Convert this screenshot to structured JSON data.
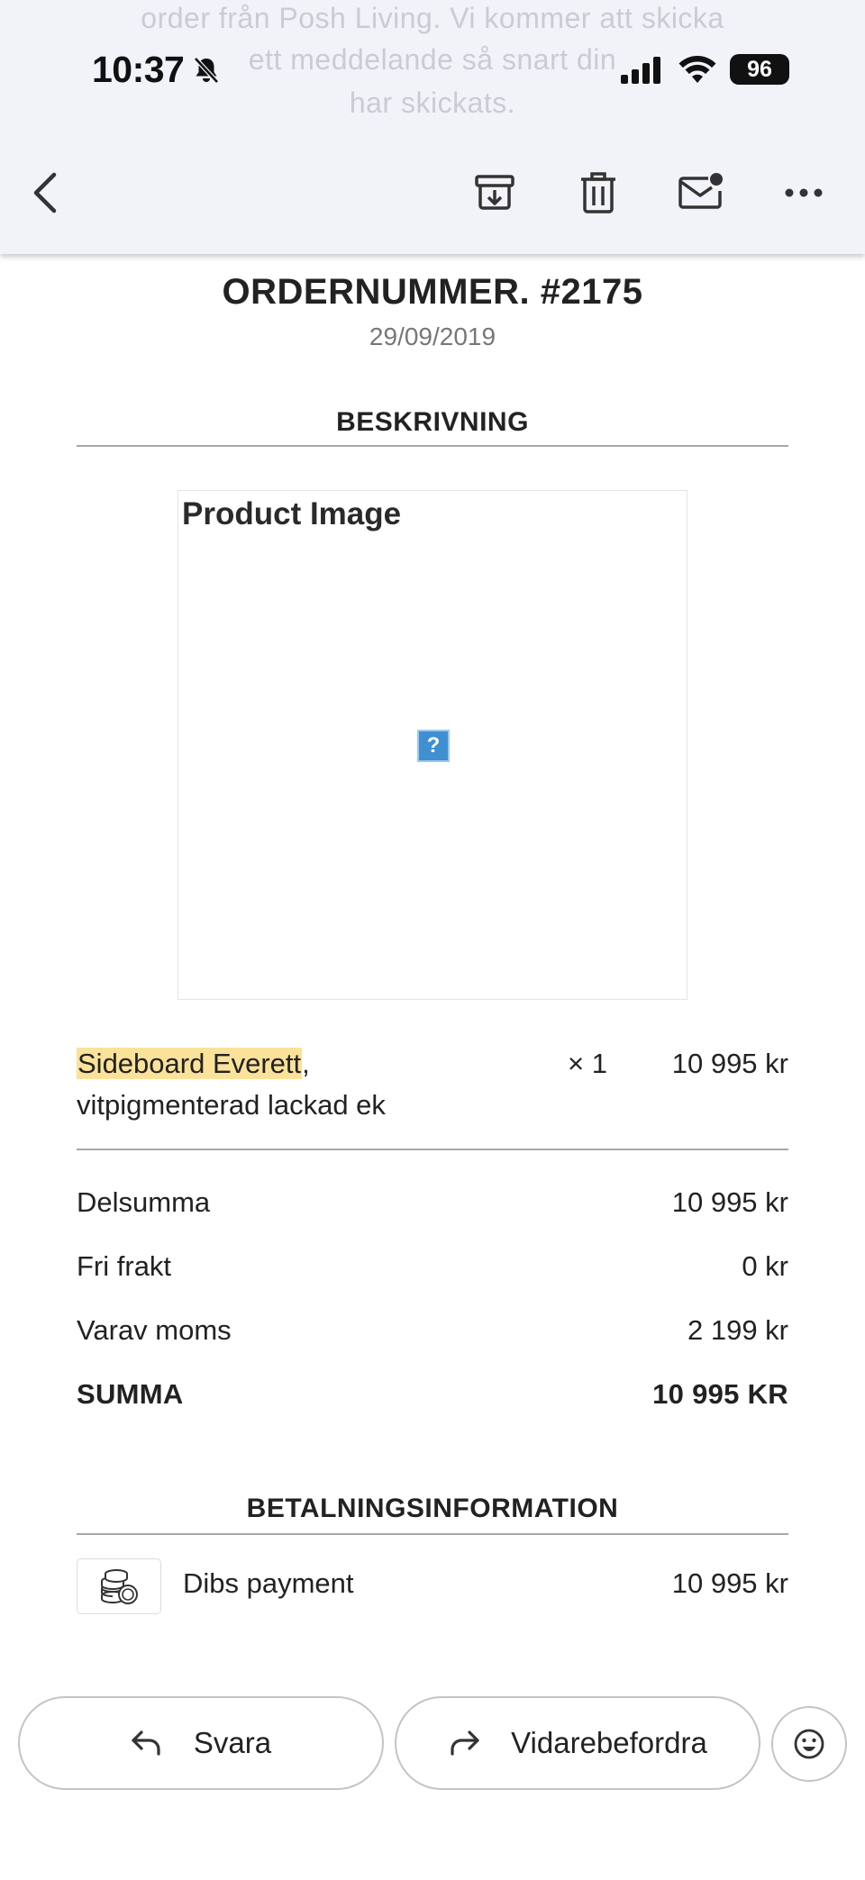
{
  "status_bar": {
    "time": "10:37",
    "battery": "96"
  },
  "header": {
    "ghost_lines": [
      "order från Posh Living. Vi kommer att skicka",
      "ett meddelande så snart din",
      "har skickats."
    ]
  },
  "order": {
    "title": "ORDERNUMMER. #2175",
    "date": "29/09/2019"
  },
  "description": {
    "heading": "BESKRIVNING",
    "image_alt": "Product Image",
    "item": {
      "name_highlighted": "Sideboard Everett",
      "name_rest": ",",
      "variant": "vitpigmenterad lackad ek",
      "quantity": "× 1",
      "price": "10 995 kr"
    }
  },
  "summary": {
    "rows": [
      {
        "label": "Delsumma",
        "value": "10 995 kr"
      },
      {
        "label": "Fri frakt",
        "value": "0 kr"
      },
      {
        "label": "Varav moms",
        "value": "2 199 kr"
      },
      {
        "label": "SUMMA",
        "value": "10 995 KR"
      }
    ]
  },
  "payment": {
    "heading": "BETALNINGSINFORMATION",
    "method": "Dibs payment",
    "amount": "10 995 kr",
    "icon": "coins-icon"
  },
  "actions": {
    "reply_label": "Svara",
    "forward_label": "Vidarebefordra"
  },
  "colors": {
    "header_bg": "#f1f3f8",
    "highlight": "#fbe29a",
    "divider": "#a8a8a8",
    "broken_image_icon": "#3f8fd1"
  }
}
